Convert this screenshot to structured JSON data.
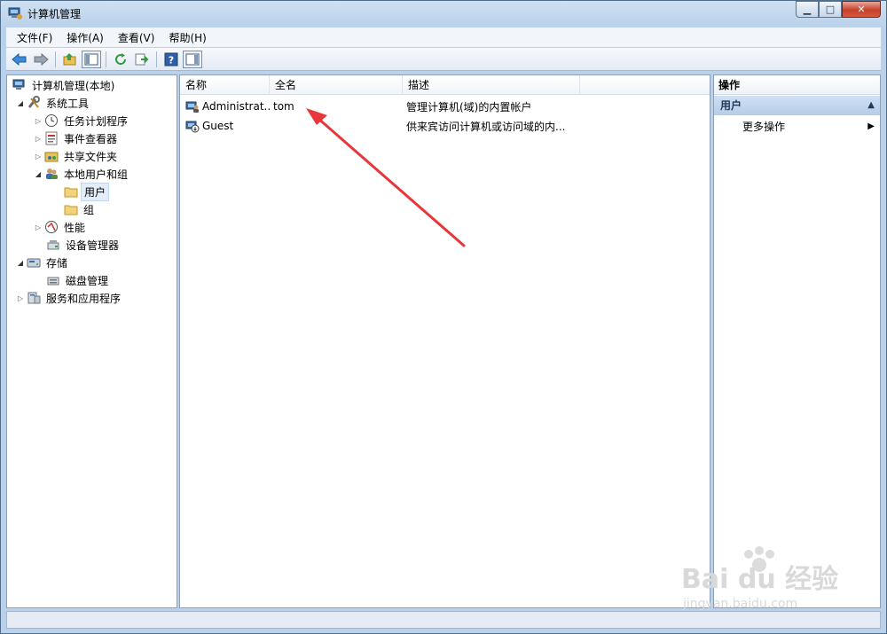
{
  "window": {
    "title": "计算机管理",
    "buttons": {
      "minimize": "▁",
      "maximize": "□",
      "close": "✕"
    }
  },
  "menu": [
    "文件(F)",
    "操作(A)",
    "查看(V)",
    "帮助(H)"
  ],
  "toolbar": [
    "back-icon",
    "forward-icon",
    "up-icon",
    "show-hide-tree-icon",
    "refresh-icon",
    "export-icon",
    "help-icon",
    "show-hide-action-icon"
  ],
  "tree": {
    "root": "计算机管理(本地)",
    "system_tools": "系统工具",
    "task_scheduler": "任务计划程序",
    "event_viewer": "事件查看器",
    "shared_folders": "共享文件夹",
    "local_users_groups": "本地用户和组",
    "users": "用户",
    "groups": "组",
    "performance": "性能",
    "device_manager": "设备管理器",
    "storage": "存储",
    "disk_management": "磁盘管理",
    "services_apps": "服务和应用程序"
  },
  "list": {
    "columns": [
      "名称",
      "全名",
      "描述"
    ],
    "rows": [
      {
        "name": "Administrat...",
        "full_name": "tom",
        "description": "管理计算机(域)的内置帐户"
      },
      {
        "name": "Guest",
        "full_name": "",
        "description": "供来宾访问计算机或访问域的内..."
      }
    ]
  },
  "actions": {
    "title": "操作",
    "section": "用户",
    "more": "更多操作"
  },
  "annotation_color": "#e8363b",
  "watermark": {
    "brand": "Bai du 经验",
    "url": "jingyan.baidu.com"
  }
}
